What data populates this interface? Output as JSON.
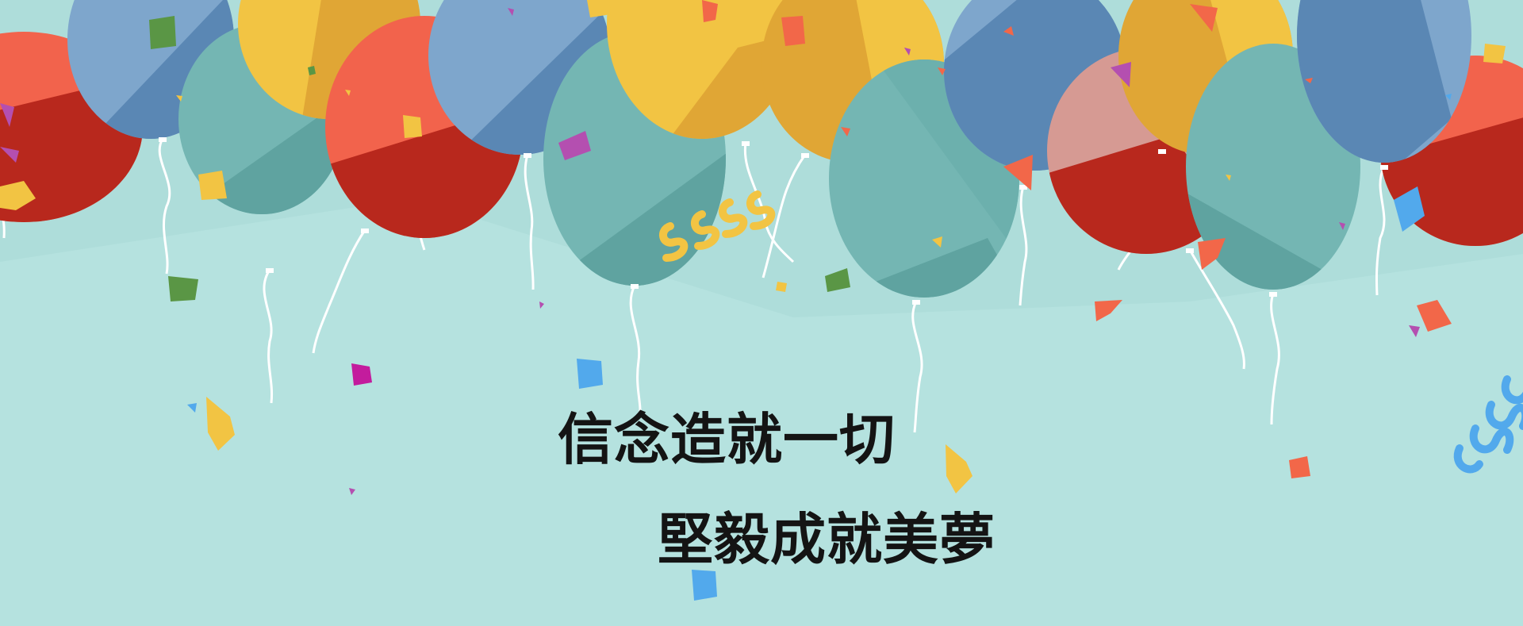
{
  "banner": {
    "slogan_line1": "信念造就一切",
    "slogan_line2": "堅毅成就美夢"
  },
  "colors": {
    "background": "#b5e2df",
    "balloon_blue": "#5a87b4",
    "balloon_blue_light": "#7ea6cc",
    "balloon_teal": "#5fa3a0",
    "balloon_teal_light": "#74b6b3",
    "balloon_yellow": "#f2c443",
    "balloon_yellow_dark": "#e0a635",
    "balloon_red": "#f2634c",
    "balloon_red_dark": "#b8281d",
    "text": "#141414"
  }
}
